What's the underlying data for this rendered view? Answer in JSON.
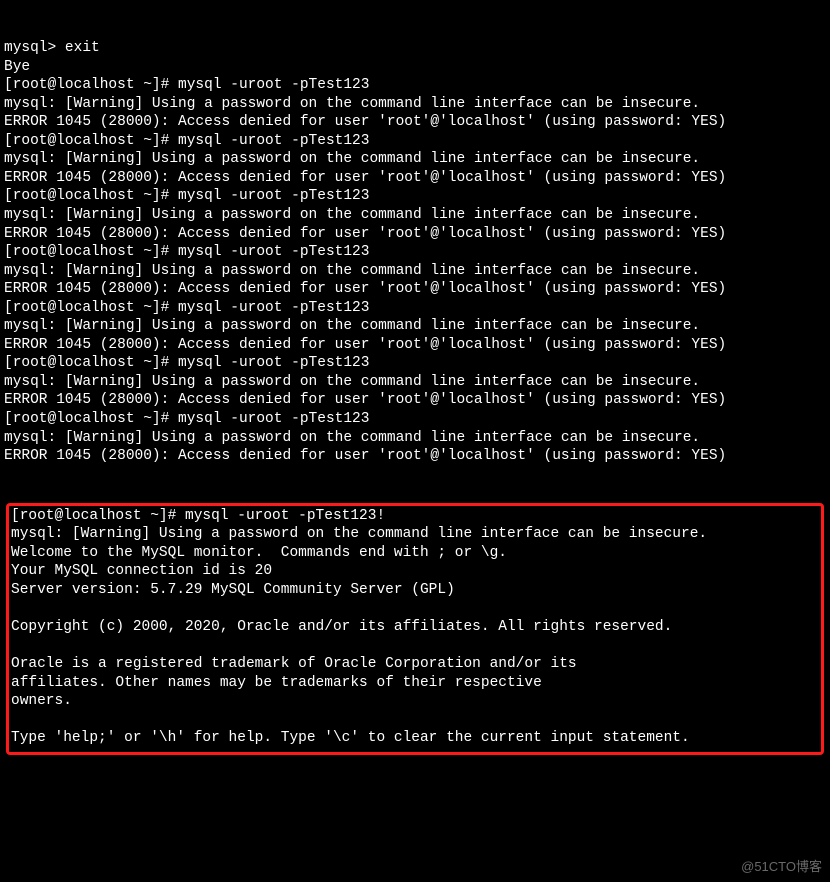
{
  "session": {
    "pre_lines": [
      "mysql> exit",
      "Bye",
      "[root@localhost ~]# mysql -uroot -pTest123",
      "mysql: [Warning] Using a password on the command line interface can be insecure.",
      "ERROR 1045 (28000): Access denied for user 'root'@'localhost' (using password: YES)",
      "[root@localhost ~]# mysql -uroot -pTest123",
      "mysql: [Warning] Using a password on the command line interface can be insecure.",
      "ERROR 1045 (28000): Access denied for user 'root'@'localhost' (using password: YES)",
      "[root@localhost ~]# mysql -uroot -pTest123",
      "mysql: [Warning] Using a password on the command line interface can be insecure.",
      "ERROR 1045 (28000): Access denied for user 'root'@'localhost' (using password: YES)",
      "[root@localhost ~]# mysql -uroot -pTest123",
      "mysql: [Warning] Using a password on the command line interface can be insecure.",
      "ERROR 1045 (28000): Access denied for user 'root'@'localhost' (using password: YES)",
      "[root@localhost ~]# mysql -uroot -pTest123",
      "mysql: [Warning] Using a password on the command line interface can be insecure.",
      "ERROR 1045 (28000): Access denied for user 'root'@'localhost' (using password: YES)",
      "[root@localhost ~]# mysql -uroot -pTest123",
      "mysql: [Warning] Using a password on the command line interface can be insecure.",
      "ERROR 1045 (28000): Access denied for user 'root'@'localhost' (using password: YES)",
      "[root@localhost ~]# mysql -uroot -pTest123",
      "mysql: [Warning] Using a password on the command line interface can be insecure.",
      "ERROR 1045 (28000): Access denied for user 'root'@'localhost' (using password: YES)"
    ],
    "box_lines": [
      "[root@localhost ~]# mysql -uroot -pTest123!",
      "mysql: [Warning] Using a password on the command line interface can be insecure.",
      "Welcome to the MySQL monitor.  Commands end with ; or \\g.",
      "Your MySQL connection id is 20",
      "Server version: 5.7.29 MySQL Community Server (GPL)",
      "",
      "Copyright (c) 2000, 2020, Oracle and/or its affiliates. All rights reserved.",
      "",
      "Oracle is a registered trademark of Oracle Corporation and/or its",
      "affiliates. Other names may be trademarks of their respective",
      "owners.",
      "",
      "Type 'help;' or '\\h' for help. Type '\\c' to clear the current input statement."
    ]
  },
  "watermark": "@51CTO博客"
}
